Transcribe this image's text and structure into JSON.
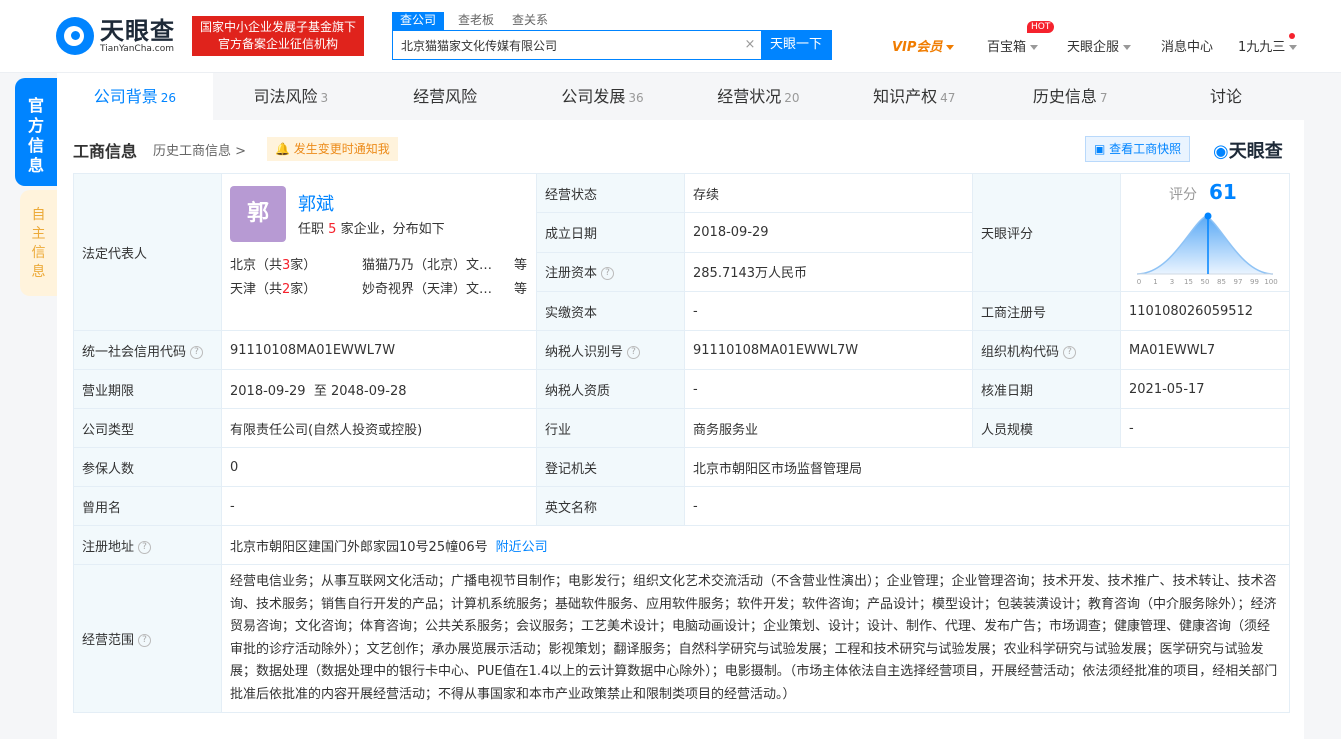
{
  "header": {
    "logo_cn": "天眼查",
    "logo_en": "TianYanCha.com",
    "badge_line1": "国家中小企业发展子基金旗下",
    "badge_line2": "官方备案企业征信机构",
    "search_tabs": [
      "查公司",
      "查老板",
      "查关系"
    ],
    "search_value": "北京猫猫家文化传媒有限公司",
    "search_button": "天眼一下",
    "nav": {
      "vip": "VIP会员",
      "treasure": "百宝箱",
      "hot": "HOT",
      "enterprise": "天眼企服",
      "messages": "消息中心",
      "user": "1九九三"
    }
  },
  "sidebar": {
    "official": "官方信息",
    "self": "自主信息"
  },
  "tabs": [
    {
      "label": "公司背景",
      "count": "26"
    },
    {
      "label": "司法风险",
      "count": "3"
    },
    {
      "label": "经营风险",
      "count": ""
    },
    {
      "label": "公司发展",
      "count": "36"
    },
    {
      "label": "经营状况",
      "count": "20"
    },
    {
      "label": "知识产权",
      "count": "47"
    },
    {
      "label": "历史信息",
      "count": "7"
    },
    {
      "label": "讨论",
      "count": ""
    }
  ],
  "section": {
    "title": "工商信息",
    "history_link": "历史工商信息",
    "alert": "发生变更时通知我",
    "snapshot": "查看工商快照",
    "brand": "天眼查"
  },
  "info": {
    "legal_rep_label": "法定代表人",
    "rep_avatar": "郭",
    "rep_name": "郭斌",
    "rep_desc_pre": "任职",
    "rep_desc_num": "5",
    "rep_desc_post": "家企业，分布如下",
    "rep_rows": [
      {
        "city": "北京（共",
        "num": "3",
        "tail": "家）",
        "company": "猫猫乃乃（北京）文…",
        "deng": "等"
      },
      {
        "city": "天津（共",
        "num": "2",
        "tail": "家）",
        "company": "妙奇视界（天津）文…",
        "deng": "等"
      }
    ],
    "status_label": "经营状态",
    "status_value": "存续",
    "founded_label": "成立日期",
    "founded_value": "2018-09-29",
    "capital_label": "注册资本",
    "capital_value": "285.7143万人民币",
    "paid_label": "实缴资本",
    "paid_value": "-",
    "score_label": "天眼评分",
    "score_title": "评分",
    "score_value": "61",
    "score_ticks": [
      "0",
      "1",
      "3",
      "15",
      "50",
      "85",
      "97",
      "99",
      "100"
    ],
    "regno_label": "工商注册号",
    "regno_value": "110108026059512",
    "credit_label": "统一社会信用代码",
    "credit_value": "91110108MA01EWWL7W",
    "taxid_label": "纳税人识别号",
    "taxid_value": "91110108MA01EWWL7W",
    "org_label": "组织机构代码",
    "org_value": "MA01EWWL7",
    "term_label": "营业期限",
    "term_value": "2018-09-29  至 2048-09-28",
    "taxq_label": "纳税人资质",
    "taxq_value": "-",
    "approve_label": "核准日期",
    "approve_value": "2021-05-17",
    "type_label": "公司类型",
    "type_value": "有限责任公司(自然人投资或控股)",
    "industry_label": "行业",
    "industry_value": "商务服务业",
    "staff_label": "人员规模",
    "staff_value": "-",
    "insured_label": "参保人数",
    "insured_value": "0",
    "authority_label": "登记机关",
    "authority_value": "北京市朝阳区市场监督管理局",
    "former_label": "曾用名",
    "former_value": "-",
    "english_label": "英文名称",
    "english_value": "-",
    "address_label": "注册地址",
    "address_value": "北京市朝阳区建国门外郎家园10号25幢06号",
    "nearby": "附近公司",
    "scope_label": "经营范围",
    "scope_value": "经营电信业务；从事互联网文化活动；广播电视节目制作；电影发行；组织文化艺术交流活动（不含营业性演出）；企业管理；企业管理咨询；技术开发、技术推广、技术转让、技术咨询、技术服务；销售自行开发的产品；计算机系统服务；基础软件服务、应用软件服务；软件开发；软件咨询；产品设计；模型设计；包装装潢设计；教育咨询（中介服务除外）；经济贸易咨询；文化咨询；体育咨询；公共关系服务；会议服务；工艺美术设计；电脑动画设计；企业策划、设计；设计、制作、代理、发布广告；市场调查；健康管理、健康咨询（须经审批的诊疗活动除外）；文艺创作；承办展览展示活动；影视策划；翻译服务；自然科学研究与试验发展；工程和技术研究与试验发展；农业科学研究与试验发展；医学研究与试验发展；数据处理（数据处理中的银行卡中心、PUE值在1.4以上的云计算数据中心除外）；电影摄制。（市场主体依法自主选择经营项目，开展经营活动；依法须经批准的项目，经相关部门批准后依批准的内容开展经营活动；不得从事国家和本市产业政策禁止和限制类项目的经营活动。）"
  }
}
